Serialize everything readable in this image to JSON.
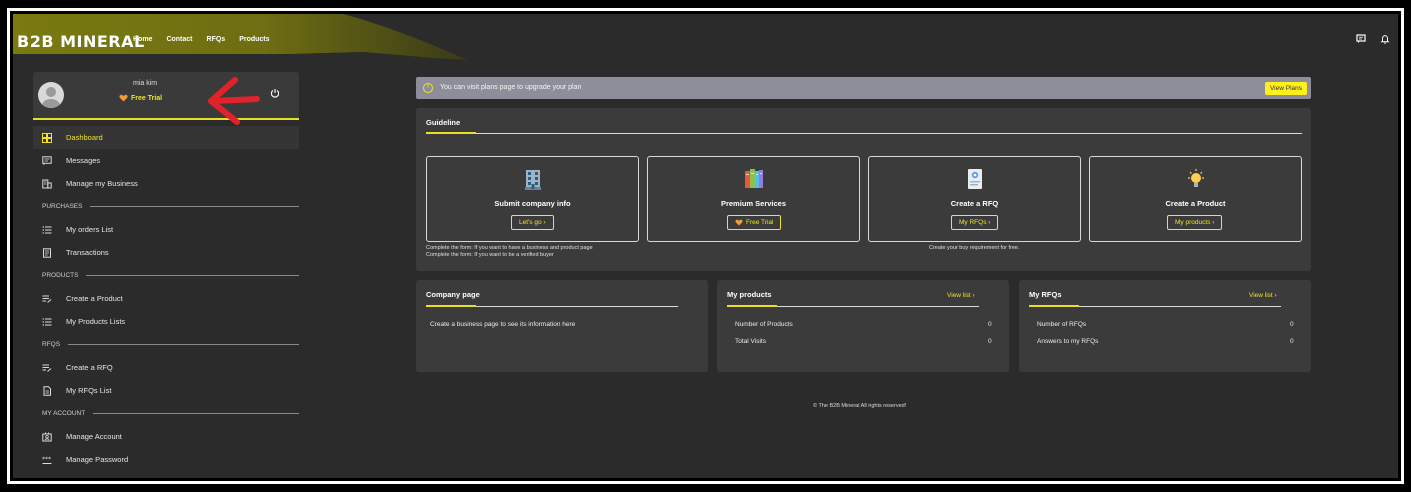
{
  "brand": {
    "logo": "B2B MINERAL",
    "accent": "#e8e025",
    "annotation_color": "#e2222a"
  },
  "nav": {
    "items": [
      "Home",
      "Contact",
      "RFQs",
      "Products"
    ]
  },
  "topbar_icons": [
    "messages-icon",
    "notification-bell-icon"
  ],
  "profile": {
    "name": "mia kim",
    "plan": "Free Trial"
  },
  "sidebar": {
    "dashboard": "Dashboard",
    "messages": "Messages",
    "manage_business": "Manage my Business",
    "purchases_header": "PURCHASES",
    "orders": "My orders List",
    "transactions": "Transactions",
    "products_header": "PRODUCTS",
    "create_product": "Create a Product",
    "product_lists": "My Products Lists",
    "rfqs_header": "RFQS",
    "create_rfq": "Create a RFQ",
    "rfqs_list": "My RFQs List",
    "account_header": "MY ACCOUNT",
    "manage_account": "Manage Account",
    "manage_password": "Manage Password"
  },
  "alert": {
    "text": "You can visit plans page to upgrade your plan",
    "button": "View Plans"
  },
  "guideline": {
    "title": "Guideline",
    "cards": [
      {
        "title": "Submit company info",
        "button": "Let's go  ›",
        "icon": "building-icon"
      },
      {
        "title": "Premium Services",
        "button": "Free Trial",
        "icon": "books-icon"
      },
      {
        "title": "Create a RFQ",
        "button": "My RFQs  ›",
        "icon": "document-icon"
      },
      {
        "title": "Create a Product",
        "button": "My products  ›",
        "icon": "lightbulb-icon"
      }
    ],
    "notes_left": [
      "Complete the form: If you want to have a business and product page",
      "Complete the form: If you want to be a verified buyer"
    ],
    "note_rfq": "Create your buy requirement for free."
  },
  "company_page": {
    "title": "Company page",
    "text": "Create a business page to see its information here"
  },
  "my_products": {
    "title": "My products",
    "link": "View list  ›",
    "rows": [
      {
        "label": "Number of Products",
        "value": "0"
      },
      {
        "label": "Total Visits",
        "value": "0"
      }
    ]
  },
  "my_rfqs": {
    "title": "My RFQs",
    "link": "View list  ›",
    "rows": [
      {
        "label": "Number of RFQs",
        "value": "0"
      },
      {
        "label": "Answers to my RFQs",
        "value": "0"
      }
    ]
  },
  "footer": "© The B2B Mineral All rights reserved!"
}
